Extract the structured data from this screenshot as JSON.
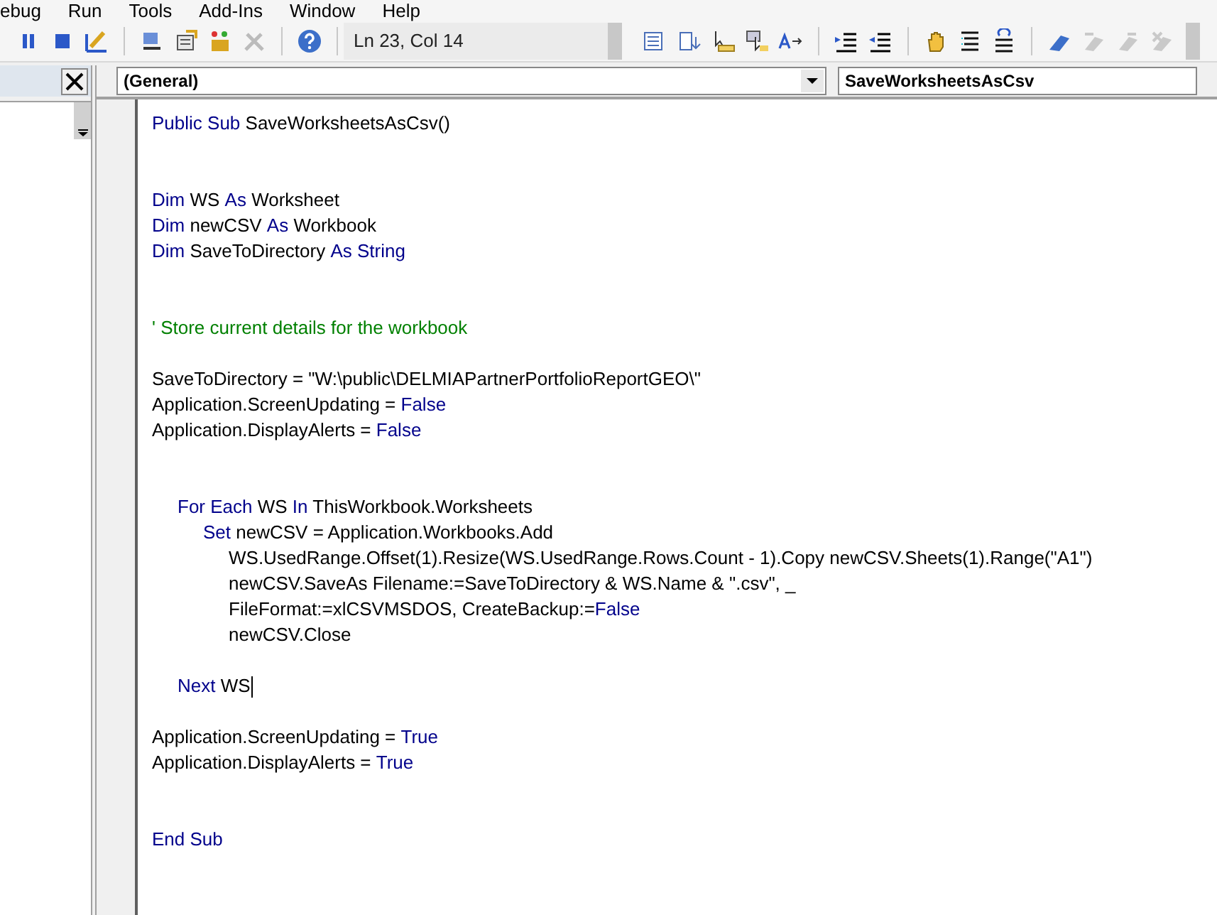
{
  "menu_bar": [
    "ebug",
    "Run",
    "Tools",
    "Add-Ins",
    "Window",
    "Help"
  ],
  "toolbar": {
    "position": "Ln 23, Col 14"
  },
  "object_dropdown": {
    "value": "(General)"
  },
  "procedure_dropdown": {
    "value": "SaveWorksheetsAsCsv"
  },
  "code_lines": [
    {
      "kind": "code",
      "tokens": [
        {
          "kind": "keyword",
          "text": "Public Sub"
        },
        {
          "kind": "plain",
          "text": " SaveWorksheetsAsCsv()"
        }
      ]
    },
    {
      "kind": "blank"
    },
    {
      "kind": "blank"
    },
    {
      "kind": "code",
      "tokens": [
        {
          "kind": "keyword",
          "text": "Dim"
        },
        {
          "kind": "plain",
          "text": " WS "
        },
        {
          "kind": "keyword",
          "text": "As"
        },
        {
          "kind": "plain",
          "text": " Worksheet"
        }
      ]
    },
    {
      "kind": "code",
      "tokens": [
        {
          "kind": "keyword",
          "text": "Dim"
        },
        {
          "kind": "plain",
          "text": " newCSV "
        },
        {
          "kind": "keyword",
          "text": "As"
        },
        {
          "kind": "plain",
          "text": " Workbook"
        }
      ]
    },
    {
      "kind": "code",
      "tokens": [
        {
          "kind": "keyword",
          "text": "Dim"
        },
        {
          "kind": "plain",
          "text": " SaveToDirectory "
        },
        {
          "kind": "keyword",
          "text": "As String"
        }
      ]
    },
    {
      "kind": "blank"
    },
    {
      "kind": "blank"
    },
    {
      "kind": "code",
      "tokens": [
        {
          "kind": "comment",
          "text": "' Store current details for the workbook"
        }
      ]
    },
    {
      "kind": "blank"
    },
    {
      "kind": "code",
      "tokens": [
        {
          "kind": "plain",
          "text": "SaveToDirectory = \"W:\\public\\DELMIAPartnerPortfolioReportGEO\\\""
        }
      ]
    },
    {
      "kind": "code",
      "tokens": [
        {
          "kind": "plain",
          "text": "Application.ScreenUpdating = "
        },
        {
          "kind": "keyword",
          "text": "False"
        }
      ]
    },
    {
      "kind": "code",
      "tokens": [
        {
          "kind": "plain",
          "text": "Application.DisplayAlerts = "
        },
        {
          "kind": "keyword",
          "text": "False"
        }
      ]
    },
    {
      "kind": "blank"
    },
    {
      "kind": "blank"
    },
    {
      "kind": "code",
      "children": [
        {
          "kind": "code",
          "tokens": [
            {
              "kind": "keyword",
              "text": "For Each"
            },
            {
              "kind": "plain",
              "text": " WS "
            },
            {
              "kind": "keyword",
              "text": "In"
            },
            {
              "kind": "plain",
              "text": " ThisWorkbook.Worksheets"
            }
          ],
          "children": [
            {
              "kind": "code",
              "tokens": [
                {
                  "kind": "keyword",
                  "text": "Set"
                },
                {
                  "kind": "plain",
                  "text": " newCSV = Application.Workbooks.Add"
                }
              ],
              "children": [
                {
                  "kind": "code",
                  "tokens": [
                    {
                      "kind": "plain",
                      "text": "WS.UsedRange.Offset(1).Resize(WS.UsedRange.Rows.Count - 1).Copy newCSV.Sheets(1).Range(\"A1\")"
                    }
                  ]
                },
                {
                  "kind": "code",
                  "tokens": [
                    {
                      "kind": "plain",
                      "text": "newCSV.SaveAs Filename:=SaveToDirectory & WS.Name & \".csv\", _"
                    }
                  ]
                },
                {
                  "kind": "code",
                  "tokens": [
                    {
                      "kind": "plain",
                      "text": "FileFormat:=xlCSVMSDOS, CreateBackup:="
                    },
                    {
                      "kind": "keyword",
                      "text": "False"
                    }
                  ]
                },
                {
                  "kind": "code",
                  "tokens": [
                    {
                      "kind": "plain",
                      "text": "newCSV.Close"
                    }
                  ]
                }
              ]
            }
          ]
        },
        {
          "kind": "blank"
        },
        {
          "kind": "code",
          "tokens": [
            {
              "kind": "keyword",
              "text": "Next"
            },
            {
              "kind": "plain",
              "text": " WS"
            }
          ],
          "cursor": true
        }
      ]
    },
    {
      "kind": "blank"
    },
    {
      "kind": "code",
      "tokens": [
        {
          "kind": "plain",
          "text": "Application.ScreenUpdating = "
        },
        {
          "kind": "keyword",
          "text": "True"
        }
      ]
    },
    {
      "kind": "code",
      "tokens": [
        {
          "kind": "plain",
          "text": "Application.DisplayAlerts = "
        },
        {
          "kind": "keyword",
          "text": "True"
        }
      ]
    },
    {
      "kind": "blank"
    },
    {
      "kind": "blank"
    },
    {
      "kind": "code",
      "tokens": [
        {
          "kind": "keyword",
          "text": "End Sub"
        }
      ]
    }
  ]
}
